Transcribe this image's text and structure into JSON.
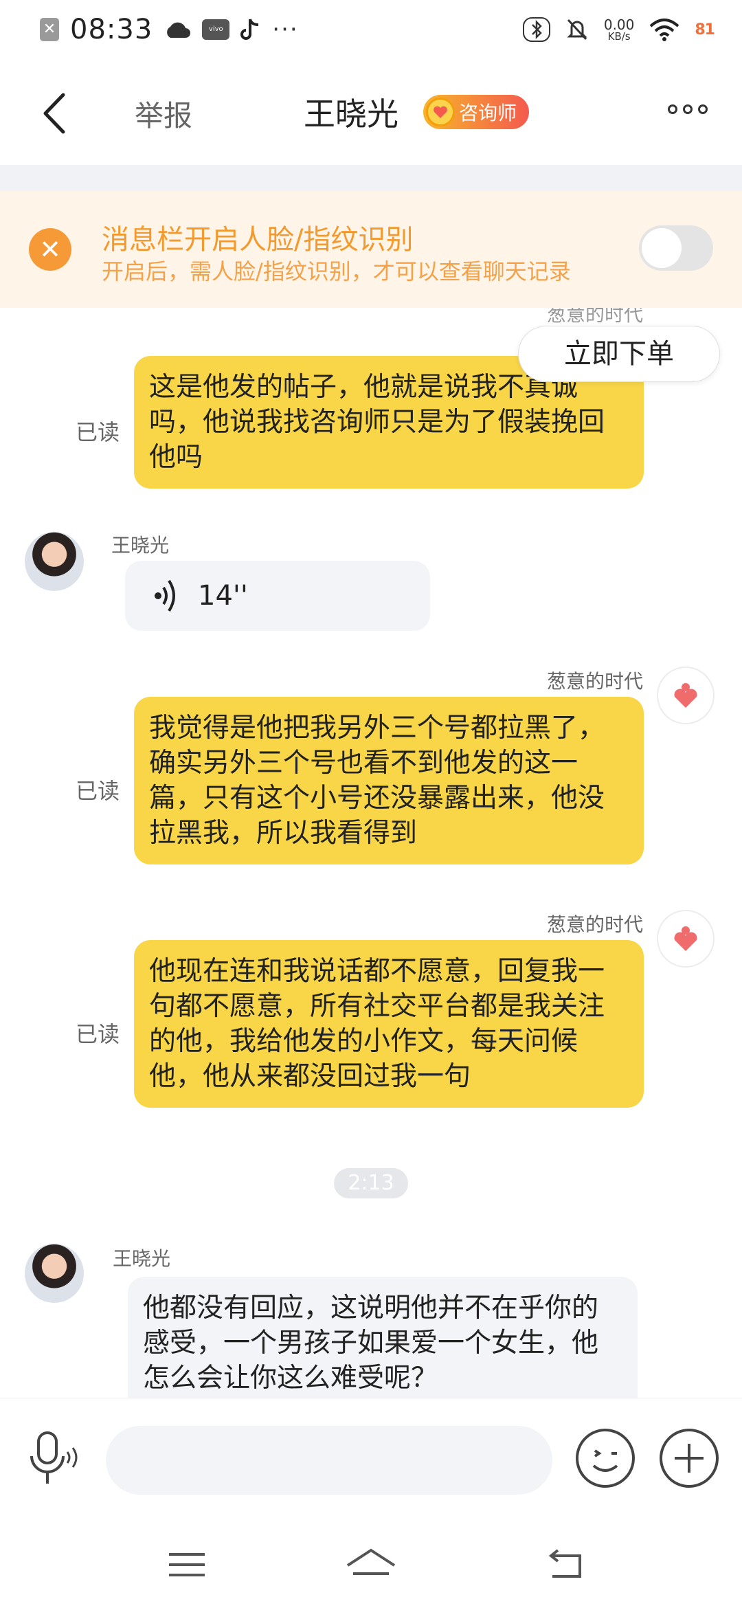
{
  "status_bar": {
    "time": "08:33",
    "vivo_label": "vivo",
    "more": "···",
    "speed_value": "0.00",
    "speed_unit": "KB/s",
    "battery": "81"
  },
  "header": {
    "report_label": "举报",
    "title": "王晓光",
    "badge_label": "咨询师"
  },
  "notice": {
    "title": "消息栏开启人脸/指纹识别",
    "subtitle": "开启后，需人脸/指纹识别，才可以查看聊天记录",
    "toggle_on": false
  },
  "chat": {
    "order_button": "立即下单",
    "read_label": "已读",
    "me_name": "葱意的时代",
    "consultant_name": "王晓光",
    "messages": [
      {
        "from": "me",
        "read": true,
        "text": "这是他发的帖子，他就是说我不真诚吗，他说我找咨询师只是为了假装挽回他吗"
      },
      {
        "from": "consultant",
        "voice_duration": "14''"
      },
      {
        "from": "me",
        "read": true,
        "text": "我觉得是他把我另外三个号都拉黑了，确实另外三个号也看不到他发的这一篇，只有这个小号还没暴露出来，他没拉黑我，所以我看得到"
      },
      {
        "from": "me",
        "read": true,
        "text": "他现在连和我说话都不愿意，回复我一句都不愿意，所有社交平台都是我关注的他，我给他发的小作文，每天问候他，他从来都没回过我一句"
      },
      {
        "from": "consultant",
        "text": "他都没有回应，这说明他并不在乎你的感受，一个男孩子如果爱一个女生，他怎么会让你这么难受呢？"
      }
    ],
    "time_divider": "2:13"
  },
  "input_bar": {
    "placeholder": ""
  },
  "icons": {
    "back": "back-arrow-icon",
    "more": "more-dots-icon",
    "close": "close-icon",
    "mic": "microphone-icon",
    "emoji": "emoji-icon",
    "plus": "plus-icon",
    "voice": "voice-wave-icon",
    "heart": "heart-avatar-icon"
  },
  "colors": {
    "accent_orange": "#f39a2e",
    "bubble_yellow": "#f8d648",
    "bubble_gray": "#f3f4f7",
    "notice_bg": "#fff4e8"
  }
}
